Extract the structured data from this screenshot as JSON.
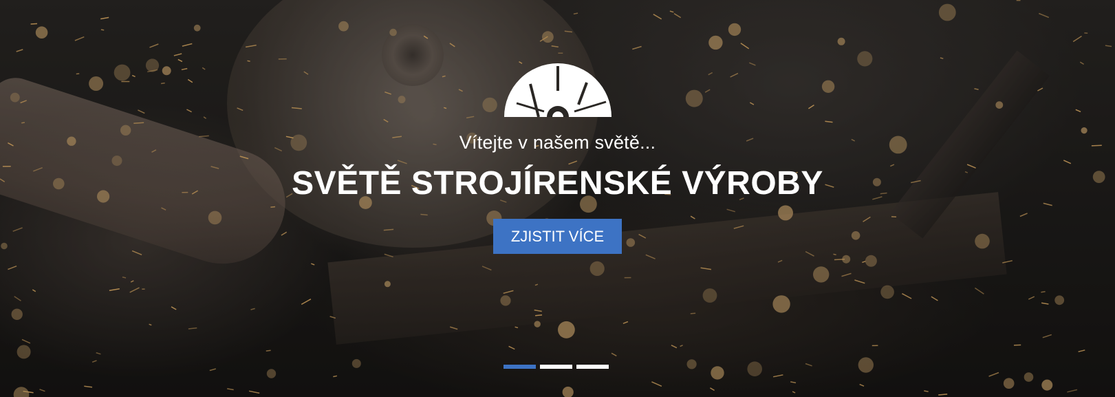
{
  "hero": {
    "subtitle": "Vítejte v našem světě...",
    "title": "SVĚTĚ STROJÍRENSKÉ VÝROBY",
    "cta_label": "ZJISTIT VÍCE",
    "accent_color": "#3d73c4",
    "logo_icon": "saw-blade-logo-icon",
    "slides": [
      {
        "active": true
      },
      {
        "active": false
      },
      {
        "active": false
      }
    ]
  }
}
